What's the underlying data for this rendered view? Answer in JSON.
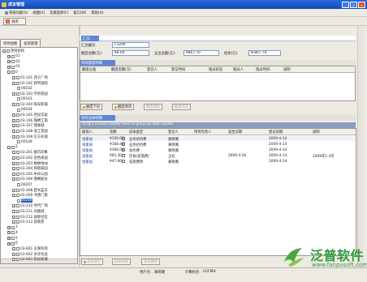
{
  "window": {
    "title": "成本管理"
  },
  "menu": [
    {
      "label": "系统功能(S)"
    },
    {
      "label": "视图(V)"
    },
    {
      "label": "功能选择(F)"
    },
    {
      "label": "窗口(W)"
    },
    {
      "label": "帮助(H)"
    }
  ],
  "toolbar": {
    "close_label": "关闭"
  },
  "left_tabs": [
    {
      "label": "项目视图"
    },
    {
      "label": "投资管理"
    }
  ],
  "tree": [
    {
      "depth": 0,
      "toggle": "-",
      "label": "项目结构"
    },
    {
      "depth": 1,
      "toggle": "+",
      "label": "01"
    },
    {
      "depth": 1,
      "toggle": "+",
      "label": "02"
    },
    {
      "depth": 1,
      "toggle": "+",
      "label": "03"
    },
    {
      "depth": 1,
      "toggle": "-",
      "label": "0"
    },
    {
      "depth": 2,
      "toggle": "-",
      "label": "03-101 西宁广场"
    },
    {
      "depth": 2,
      "toggle": "-",
      "label": "03-102 和平国际"
    },
    {
      "depth": 3,
      "toggle": "",
      "label": "00102"
    },
    {
      "depth": 2,
      "toggle": "-",
      "label": "03-103 学府花园"
    },
    {
      "depth": 3,
      "toggle": "",
      "label": "00103"
    },
    {
      "depth": 2,
      "toggle": "-",
      "label": "03-104 阳光新城"
    },
    {
      "depth": 3,
      "toggle": "",
      "label": "00104"
    },
    {
      "depth": 2,
      "toggle": "-",
      "label": "03-105 世纪华庭"
    },
    {
      "depth": 2,
      "toggle": "-",
      "label": "03-106 锦绣江南"
    },
    {
      "depth": 2,
      "toggle": "-",
      "label": "03-107 翡翠城"
    },
    {
      "depth": 2,
      "toggle": "-",
      "label": "03-108 滨江花园"
    },
    {
      "depth": 2,
      "toggle": "-",
      "label": "03-109 东方名城"
    },
    {
      "depth": 3,
      "toggle": "",
      "label": "00109"
    },
    {
      "depth": 1,
      "toggle": "-",
      "label": "2"
    },
    {
      "depth": 2,
      "toggle": "-",
      "label": "03-201 都市印象"
    },
    {
      "depth": 2,
      "toggle": "-",
      "label": "03-202 金色家园"
    },
    {
      "depth": 2,
      "toggle": "-",
      "label": "03-203 枫林绿洲"
    },
    {
      "depth": 2,
      "toggle": "-",
      "label": "03-204 和谐家园"
    },
    {
      "depth": 2,
      "toggle": "-",
      "label": "03-205 中央公园"
    },
    {
      "depth": 2,
      "toggle": "-",
      "label": "03-206 香榭丽舍"
    },
    {
      "depth": 3,
      "toggle": "",
      "label": "00207"
    },
    {
      "depth": 2,
      "toggle": "-",
      "label": "03-208 碧水蓝天"
    },
    {
      "depth": 2,
      "toggle": "-",
      "label": "03-209 书香门第"
    },
    {
      "depth": 3,
      "toggle": "",
      "label": "00209",
      "selected": true
    },
    {
      "depth": 2,
      "toggle": "-",
      "label": "03-210 时代广场"
    },
    {
      "depth": 2,
      "toggle": "-",
      "label": "03-211 凤凰城"
    },
    {
      "depth": 2,
      "toggle": "-",
      "label": "03-212 国际社区"
    },
    {
      "depth": 2,
      "toggle": "-",
      "label": "03-213 丽景苑"
    },
    {
      "depth": 1,
      "toggle": "+",
      "label": "3"
    },
    {
      "depth": 1,
      "toggle": "+",
      "label": "4"
    },
    {
      "depth": 1,
      "toggle": "+",
      "label": "5"
    },
    {
      "depth": 1,
      "toggle": "+",
      "label": "6"
    },
    {
      "depth": 2,
      "toggle": "-",
      "label": "03-601 东湖名苑"
    },
    {
      "depth": 2,
      "toggle": "-",
      "label": "03-602 水岸名居"
    },
    {
      "depth": 2,
      "toggle": "-",
      "label": "03-603 阳光丽城"
    }
  ],
  "detail": {
    "tag": "汇总",
    "fields": {
      "code_label": "汇总编号:",
      "code_value": "F3209",
      "budget_label": "额度总额(元):",
      "budget_value": "¥0.00",
      "paid_label": "支出总额(元):",
      "paid_value": "¥867.70",
      "balance_label": "结余(元):",
      "balance_value": "¥-867.70"
    }
  },
  "top_section": {
    "title": "项目额度明细",
    "columns": [
      "额度分类",
      "额度金额(元)",
      "登记人",
      "登记时间",
      "指派状态",
      "指派人",
      "指派时间",
      "说明"
    ],
    "buttons": [
      {
        "label": "额度下达",
        "enabled": true
      },
      {
        "label": "额度修改",
        "enabled": true
      },
      {
        "label": "额度删除",
        "enabled": false
      },
      {
        "label": "额度浏览",
        "enabled": false
      }
    ]
  },
  "bottom_section": {
    "title": "项目成本明细",
    "group_hint": "Drag a column header here to group by that column",
    "columns": [
      "报销人",
      "金额",
      "成本类型",
      "登记人",
      "项目负责人",
      "发生日期",
      "登记日期",
      "说明"
    ],
    "rows": [
      {
        "person": "张俊丽",
        "amount": "¥106.00",
        "type": "业务招待费",
        "registrar": "黄晓璐",
        "manager": "",
        "occur": "",
        "reg": "2009-4-14",
        "note": ""
      },
      {
        "person": "张俊丽",
        "amount": "¥168.40",
        "type": "业务招待费",
        "registrar": "黄晓璐",
        "manager": "",
        "occur": "",
        "reg": "2009-4-14",
        "note": ""
      },
      {
        "person": "张俊丽",
        "amount": "¥390.00",
        "type": "会务费",
        "registrar": "黄晓璐",
        "manager": "",
        "occur": "",
        "reg": "2009-4-14",
        "note": ""
      },
      {
        "person": "张俊丽",
        "amount": "¥65.30",
        "type": "饮食(差旅费)",
        "registrar": "王虹",
        "manager": "",
        "occur": "2009-3-26",
        "reg": "2009-4-14",
        "note": "2009年1-3月"
      },
      {
        "person": "张俊丽",
        "amount": "¥47.60",
        "type": "差旅费用",
        "registrar": "黄晓璐",
        "manager": "",
        "occur": "",
        "reg": "2009-4-14",
        "note": ""
      }
    ],
    "buttons": [
      {
        "label": "成本登记",
        "enabled": false
      },
      {
        "label": "成本修改",
        "enabled": false
      },
      {
        "label": "成本删除",
        "enabled": false
      }
    ]
  },
  "status": {
    "user_label": "用户名:",
    "user_value": "黄晓璐",
    "machine_label": "计算机名:",
    "machine_value": "LOCMH"
  },
  "logo": {
    "name": "泛普软件",
    "url": "www.fanpusoft.com"
  },
  "colors": {
    "titlebar": "#1f5bd0",
    "tab_blue": "#5f86d4",
    "selection": "#2a5fbf",
    "logo_green": "#2e9a3a"
  }
}
